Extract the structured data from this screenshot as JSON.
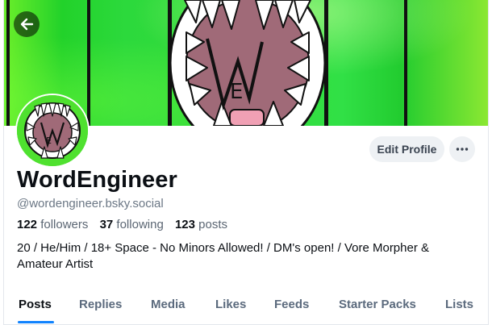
{
  "profile": {
    "display_name": "WordEngineer",
    "handle": "@wordengineer.bsky.social",
    "bio": "20 / He/Him / 18+ Space - No Minors Allowed! / DM's open! / Vore Morpher & Amateur Artist"
  },
  "stats": {
    "followers_count": "122",
    "followers_label": "followers",
    "following_count": "37",
    "following_label": "following",
    "posts_count": "123",
    "posts_label": "posts"
  },
  "actions": {
    "edit_profile_label": "Edit Profile"
  },
  "tabs": [
    {
      "label": "Posts",
      "active": true
    },
    {
      "label": "Replies"
    },
    {
      "label": "Media"
    },
    {
      "label": "Likes"
    },
    {
      "label": "Feeds"
    },
    {
      "label": "Starter Packs"
    },
    {
      "label": "Lists"
    }
  ],
  "icons": {
    "back": "arrow-left-icon",
    "more": "ellipsis-icon"
  },
  "colors": {
    "accent": "#1083fe",
    "banner_green": "#34dc3a",
    "button_bg": "#eef1f4",
    "muted_text": "#6b7785"
  }
}
